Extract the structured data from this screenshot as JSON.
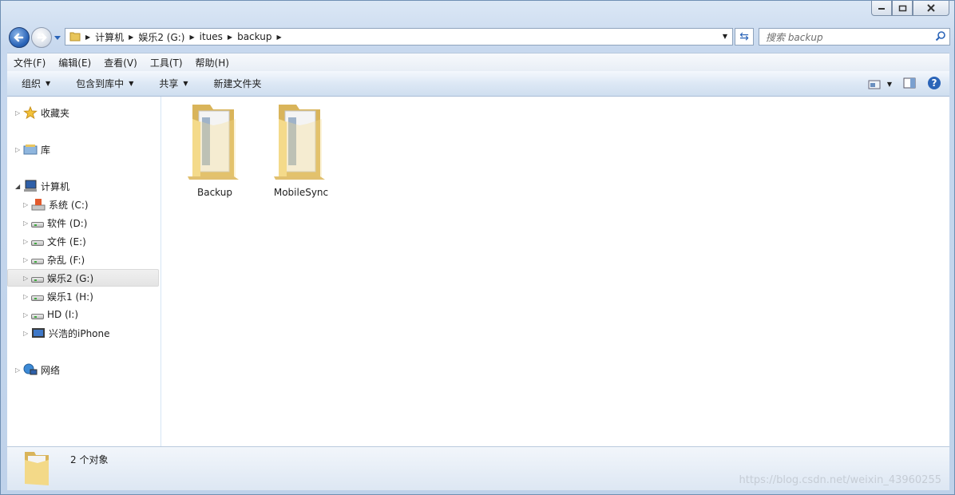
{
  "address": {
    "crumbs": [
      "计算机",
      "娱乐2 (G:)",
      "itues",
      "backup"
    ]
  },
  "search": {
    "placeholder": "搜索 backup"
  },
  "menubar": [
    "文件(F)",
    "编辑(E)",
    "查看(V)",
    "工具(T)",
    "帮助(H)"
  ],
  "commands": {
    "organize": "组织",
    "include_library": "包含到库中",
    "share": "共享",
    "new_folder": "新建文件夹"
  },
  "nav": {
    "favorites": "收藏夹",
    "libraries": "库",
    "computer": "计算机",
    "drives": [
      "系统 (C:)",
      "软件 (D:)",
      "文件 (E:)",
      "杂乱 (F:)",
      "娱乐2 (G:)",
      "娱乐1 (H:)",
      "HD (I:)",
      "兴浩的iPhone"
    ],
    "network": "网络"
  },
  "folders": [
    "Backup",
    "MobileSync"
  ],
  "status": {
    "count": "2 个对象"
  },
  "watermark": "https://blog.csdn.net/weixin_43960255",
  "colors": {
    "accent": "#2a64b8",
    "folder": "#f2d27a"
  }
}
